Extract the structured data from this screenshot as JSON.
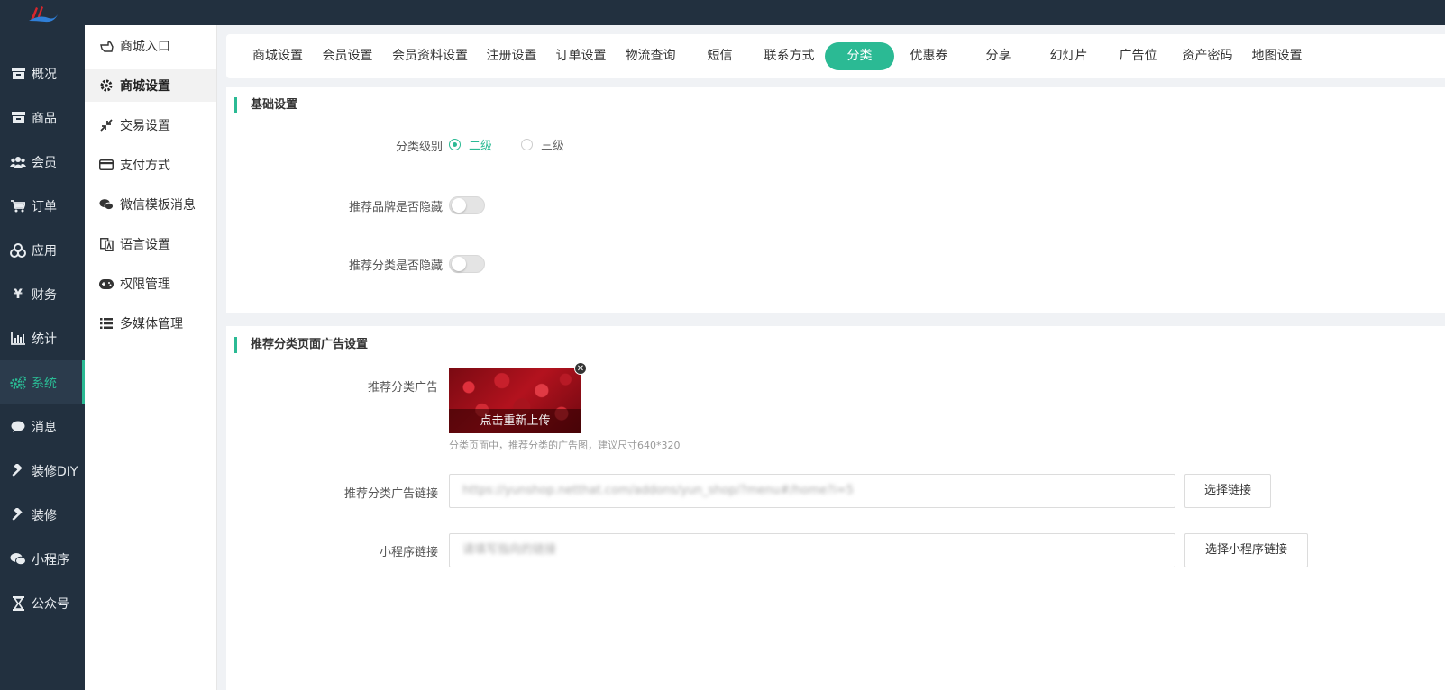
{
  "colors": {
    "accent": "#2bba94",
    "sidebar_bg": "#22303f",
    "logo_red": "#d8262c",
    "logo_blue": "#2f7fd8"
  },
  "main_nav": [
    {
      "icon": "dashboard-icon",
      "label": "概况"
    },
    {
      "icon": "goods-icon",
      "label": "商品"
    },
    {
      "icon": "members-icon",
      "label": "会员"
    },
    {
      "icon": "cart-icon",
      "label": "订单"
    },
    {
      "icon": "apps-icon",
      "label": "应用"
    },
    {
      "icon": "yen-icon",
      "label": "财务"
    },
    {
      "icon": "stats-icon",
      "label": "统计"
    },
    {
      "icon": "gears-icon",
      "label": "系统",
      "active": true
    },
    {
      "icon": "message-icon",
      "label": "消息"
    },
    {
      "icon": "hammer-icon",
      "label": "装修DIY"
    },
    {
      "icon": "hammer-icon",
      "label": "装修"
    },
    {
      "icon": "wechat-icon",
      "label": "小程序"
    },
    {
      "icon": "hourglass-icon",
      "label": "公众号"
    }
  ],
  "sub_nav": [
    {
      "icon": "hand-pointer-icon",
      "label": "商城入口"
    },
    {
      "icon": "gear-icon",
      "label": "商城设置",
      "active": true
    },
    {
      "icon": "compress-icon",
      "label": "交易设置"
    },
    {
      "icon": "credit-card-icon",
      "label": "支付方式"
    },
    {
      "icon": "wechat-icon",
      "label": "微信模板消息"
    },
    {
      "icon": "language-icon",
      "label": "语言设置"
    },
    {
      "icon": "gamepad-icon",
      "label": "权限管理"
    },
    {
      "icon": "list-icon",
      "label": "多媒体管理"
    }
  ],
  "tabs": [
    {
      "label": "商城设置"
    },
    {
      "label": "会员设置"
    },
    {
      "label": "会员资料设置"
    },
    {
      "label": "注册设置"
    },
    {
      "label": "订单设置"
    },
    {
      "label": "物流查询"
    },
    {
      "label": "短信"
    },
    {
      "label": "联系方式"
    },
    {
      "label": "分类",
      "active": true
    },
    {
      "label": "优惠券"
    },
    {
      "label": "分享"
    },
    {
      "label": "幻灯片"
    },
    {
      "label": "广告位"
    },
    {
      "label": "资产密码"
    },
    {
      "label": "地图设置"
    }
  ],
  "basic": {
    "title": "基础设置",
    "level_label": "分类级别",
    "level_options": [
      {
        "label": "二级",
        "checked": true
      },
      {
        "label": "三级",
        "checked": false
      }
    ],
    "brand_hide_label": "推荐品牌是否隐藏",
    "brand_hide_on": false,
    "category_hide_label": "推荐分类是否隐藏",
    "category_hide_on": false
  },
  "ad": {
    "title": "推荐分类页面广告设置",
    "image_label": "推荐分类广告",
    "reupload_text": "点击重新上传",
    "hint": "分类页面中，推荐分类的广告图，建议尺寸640*320",
    "link_label": "推荐分类广告链接",
    "link_value": "https://yunshop.netthat.com/addons/yun_shop/?menu#/home?i=5",
    "link_button": "选择链接",
    "mini_label": "小程序链接",
    "mini_placeholder": "请填写指向的链接",
    "mini_button": "选择小程序链接"
  }
}
